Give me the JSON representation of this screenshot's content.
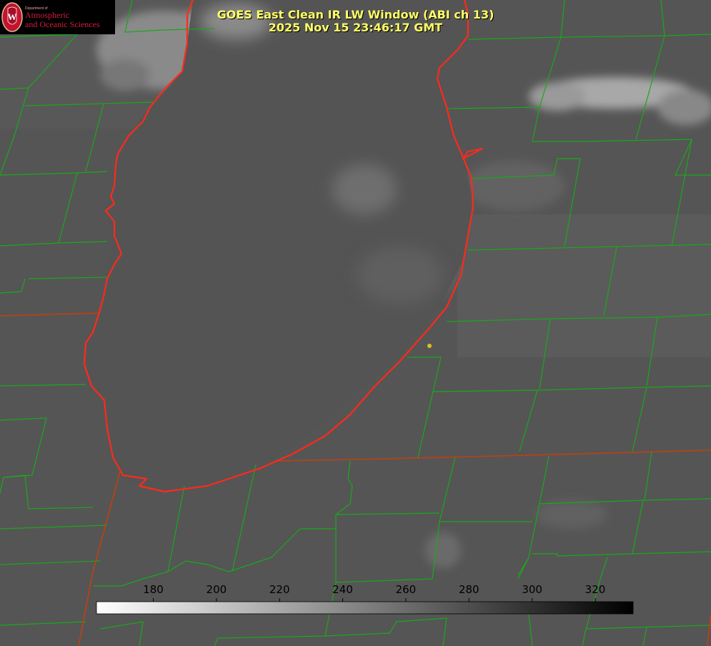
{
  "header": {
    "title": "GOES East Clean IR LW Window (ABI ch 13)",
    "timestamp": "2025 Nov 15 23:46:17 GMT"
  },
  "logo": {
    "department": "Department of",
    "line1": "Atmospheric",
    "line2": "and Oceanic Sciences"
  },
  "colorbar": {
    "ticks": [
      "180",
      "200",
      "220",
      "240",
      "260",
      "280",
      "300",
      "320"
    ],
    "tick_values": [
      180,
      200,
      220,
      240,
      260,
      280,
      300,
      320
    ],
    "range": [
      162,
      332
    ],
    "gradient": "light-to-dark"
  },
  "colors": {
    "title_text": "#ffff66",
    "county_lines": "#1aa81a",
    "state_lines": "#c04010",
    "coastline": "#ff2a1a",
    "station_marker": "#e0c020",
    "logo_red": "#d21e3c"
  }
}
